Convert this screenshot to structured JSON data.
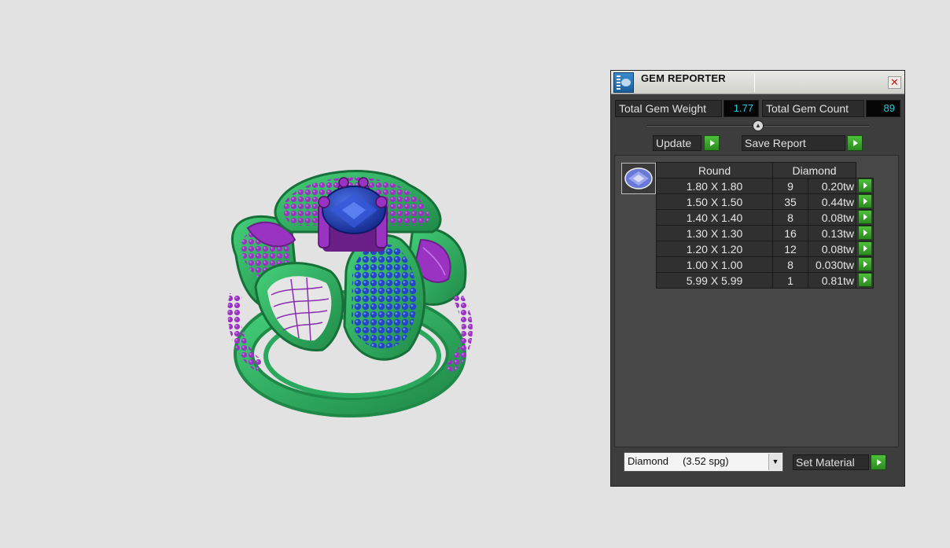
{
  "panel": {
    "title": "GEM REPORTER",
    "close_label": "✕",
    "stats": {
      "total_weight_label": "Total Gem Weight",
      "total_weight_value": "1.77",
      "total_count_label": "Total Gem Count",
      "total_count_value": "89"
    },
    "buttons": {
      "update": "Update",
      "save_report": "Save Report",
      "set_material": "Set Material"
    },
    "table": {
      "headers": {
        "shape": "Round",
        "material": "Diamond"
      },
      "rows": [
        {
          "size": "1.80 X 1.80",
          "count": "9",
          "weight": "0.20tw"
        },
        {
          "size": "1.50 X 1.50",
          "count": "35",
          "weight": "0.44tw"
        },
        {
          "size": "1.40 X 1.40",
          "count": "8",
          "weight": "0.08tw"
        },
        {
          "size": "1.30 X 1.30",
          "count": "16",
          "weight": "0.13tw"
        },
        {
          "size": "1.20 X 1.20",
          "count": "12",
          "weight": "0.08tw"
        },
        {
          "size": "1.00 X 1.00",
          "count": "8",
          "weight": "0.030tw"
        },
        {
          "size": "5.99 X 5.99",
          "count": "1",
          "weight": "0.81tw"
        }
      ]
    },
    "material_select": {
      "value": "Diamond     (3.52 spg)",
      "arrow": "▼"
    }
  },
  "colors": {
    "metal_green": "#2fb86a",
    "prong_purple": "#8a2fb0",
    "gem_blue": "#1f3fb8",
    "value_cyan": "#27c8d8",
    "action_green": "#3aa52a"
  }
}
